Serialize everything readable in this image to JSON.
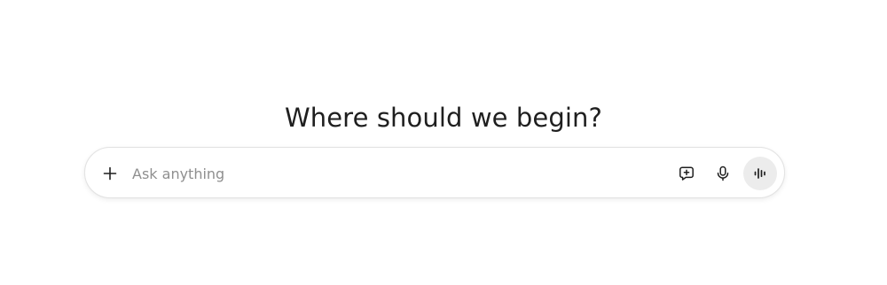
{
  "main": {
    "heading": "Where should we begin?"
  },
  "composer": {
    "placeholder": "Ask anything",
    "value": "",
    "icons": {
      "attach": "plus-icon",
      "temporary_chat": "chat-plus-icon",
      "dictate": "microphone-icon",
      "voice_mode": "voice-waveform-icon"
    },
    "colors": {
      "icon": "#1f1f1f",
      "placeholder": "#8f8f8f",
      "voice_button_bg": "#ececec",
      "border": "#e3e3e3"
    }
  }
}
